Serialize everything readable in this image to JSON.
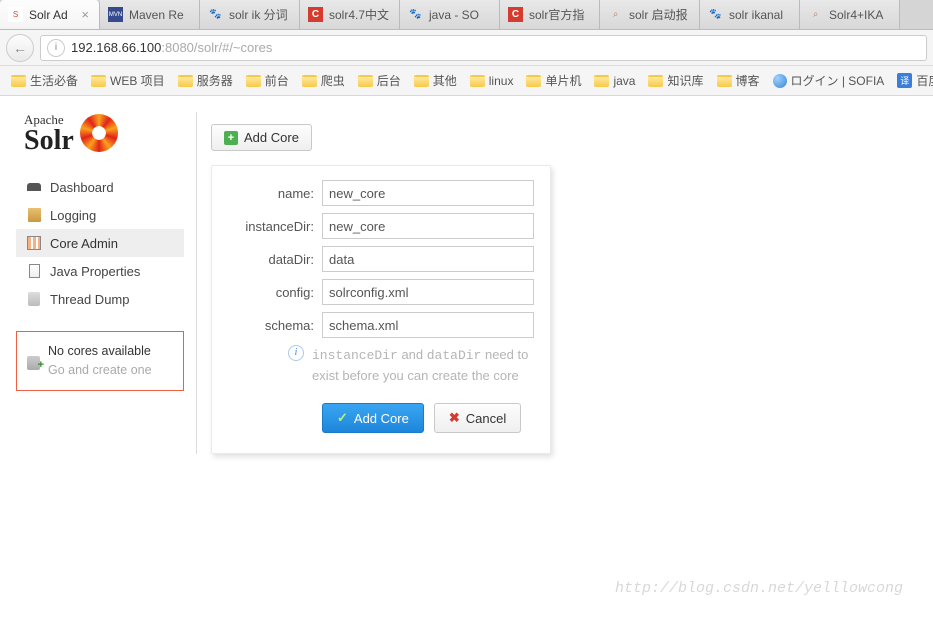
{
  "tabs": [
    {
      "label": "Solr Ad",
      "active": true,
      "fav": "solr"
    },
    {
      "label": "Maven Re",
      "fav": "mvn"
    },
    {
      "label": "solr ik 分词",
      "fav": "baidu"
    },
    {
      "label": "solr4.7中文",
      "fav": "csdn"
    },
    {
      "label": "java - SO",
      "fav": "baidu"
    },
    {
      "label": "solr官方指",
      "fav": "csdn"
    },
    {
      "label": "solr 启动报",
      "fav": "search"
    },
    {
      "label": "solr ikanal",
      "fav": "baidu"
    },
    {
      "label": "Solr4+IKA",
      "fav": "search"
    }
  ],
  "url": {
    "host": "192.168.66.100",
    "port": ":8080",
    "path": "/solr/#/~cores"
  },
  "bookmarks": [
    "生活必备",
    "WEB 项目",
    "服务器",
    "前台",
    "爬虫",
    "后台",
    "其他",
    "linux",
    "单片机",
    "java",
    "知识库",
    "博客"
  ],
  "extraBookmarks": {
    "login": "ログイン | SOFIA",
    "translate": "百度翻译"
  },
  "logo": {
    "top": "Apache",
    "bottom": "Solr"
  },
  "nav": {
    "dashboard": "Dashboard",
    "logging": "Logging",
    "coreadmin": "Core Admin",
    "javaprops": "Java Properties",
    "threaddump": "Thread Dump"
  },
  "corebox": {
    "line1": "No cores available",
    "line2": "Go and create one"
  },
  "toolbar": {
    "addcore": "Add Core"
  },
  "form": {
    "labels": {
      "name": "name:",
      "instanceDir": "instanceDir:",
      "dataDir": "dataDir:",
      "config": "config:",
      "schema": "schema:"
    },
    "values": {
      "name": "new_core",
      "instanceDir": "new_core",
      "dataDir": "data",
      "config": "solrconfig.xml",
      "schema": "schema.xml"
    },
    "info_pre": "instanceDir",
    "info_mid": " and ",
    "info_code2": "dataDir",
    "info_post": " need to exist before you can create the core",
    "submit": "Add Core",
    "cancel": "Cancel"
  },
  "watermark": "http://blog.csdn.net/yelllowcong"
}
